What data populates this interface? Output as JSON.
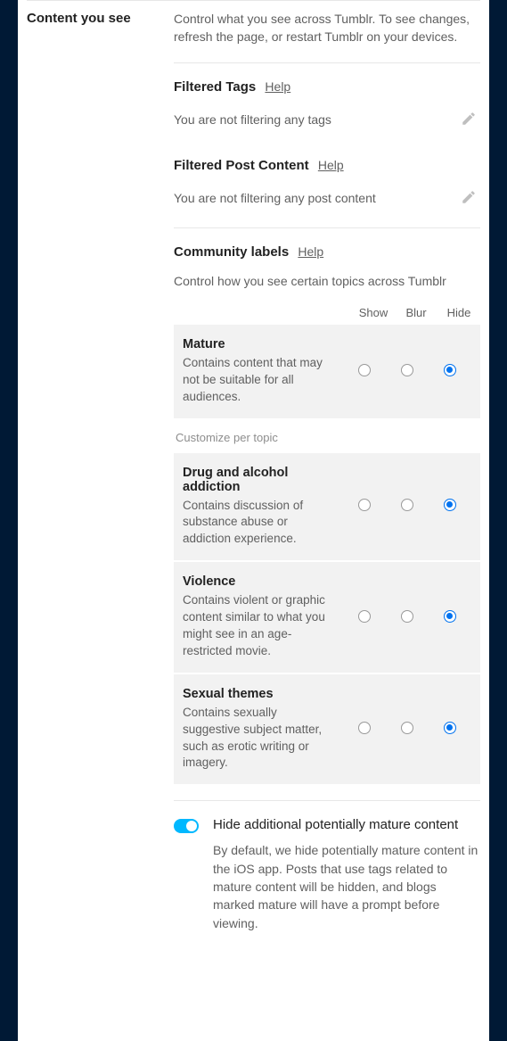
{
  "section": {
    "title": "Content you see",
    "description": "Control what you see across Tumblr. To see changes, refresh the page, or restart Tumblr on your devices."
  },
  "filtered_tags": {
    "heading": "Filtered Tags",
    "help": "Help",
    "empty": "You are not filtering any tags"
  },
  "filtered_content": {
    "heading": "Filtered Post Content",
    "help": "Help",
    "empty": "You are not filtering any post content"
  },
  "community": {
    "heading": "Community labels",
    "help": "Help",
    "description": "Control how you see certain topics across Tumblr",
    "columns": {
      "show": "Show",
      "blur": "Blur",
      "hide": "Hide"
    },
    "customize_heading": "Customize per topic",
    "labels": [
      {
        "id": "mature",
        "title": "Mature",
        "desc": "Contains content that may not be suitable for all audiences.",
        "value": "hide"
      },
      {
        "id": "drug",
        "title": "Drug and alcohol addiction",
        "desc": "Contains discussion of substance abuse or addiction experience.",
        "value": "hide"
      },
      {
        "id": "violence",
        "title": "Violence",
        "desc": "Contains violent or graphic content similar to what you might see in an age-restricted movie.",
        "value": "hide"
      },
      {
        "id": "sexual",
        "title": "Sexual themes",
        "desc": "Contains sexually suggestive subject matter, such as erotic writing or imagery.",
        "value": "hide"
      }
    ]
  },
  "hide_mature": {
    "title": "Hide additional potentially mature content",
    "desc": "By default, we hide potentially mature content in the iOS app. Posts that use tags related to mature content will be hidden, and blogs marked mature will have a prompt before viewing.",
    "enabled": true
  }
}
